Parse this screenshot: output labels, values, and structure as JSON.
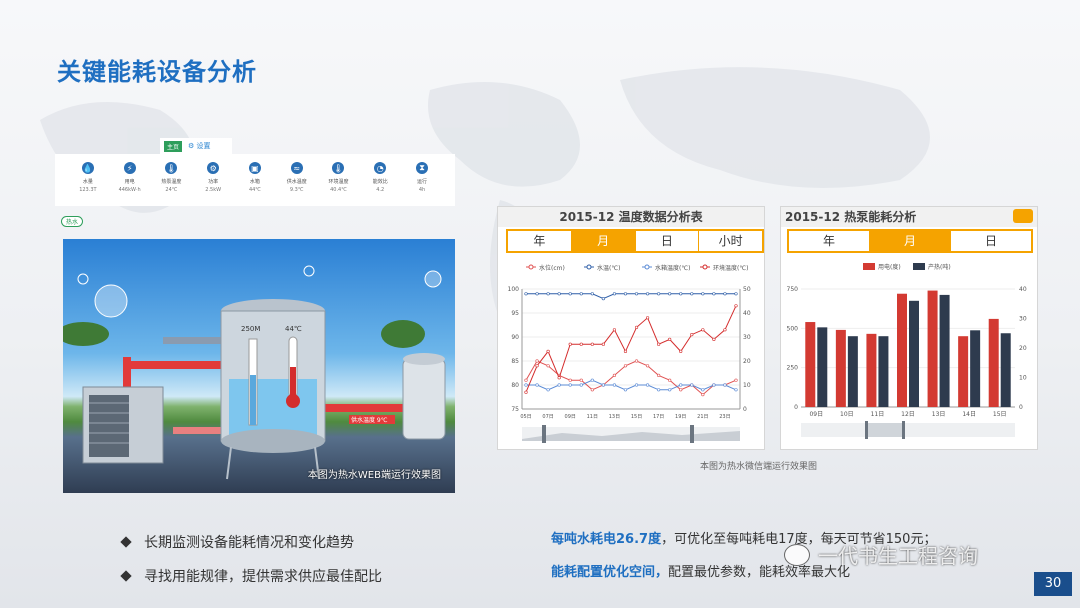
{
  "slide": {
    "title": "关键能耗设备分析",
    "page_number": "30"
  },
  "left_screenshot": {
    "tab_green": "主页",
    "tab_settings": "设置",
    "logo": "热水",
    "sensors": [
      {
        "icon": "water-drop-icon",
        "label": "水量",
        "value": "123.3T"
      },
      {
        "icon": "bolt-icon",
        "label": "用电",
        "value": "446kW·h"
      },
      {
        "icon": "thermometer-icon",
        "label": "热泵温度",
        "value": "24℃"
      },
      {
        "icon": "pump-icon",
        "label": "功率",
        "value": "2.5kW"
      },
      {
        "icon": "tank-icon",
        "label": "水箱",
        "value": "44℃"
      },
      {
        "icon": "pipe-icon",
        "label": "供水温度",
        "value": "9.3℃"
      },
      {
        "icon": "thermo-icon",
        "label": "环境温度",
        "value": "40.4℃"
      },
      {
        "icon": "gauge-icon",
        "label": "能效比",
        "value": "4.2"
      },
      {
        "icon": "hourglass-icon",
        "label": "运行",
        "value": "4h"
      }
    ],
    "tank_level_label": "250M",
    "tank_temp_label": "44℃",
    "pipe_label": "供水温度 9℃",
    "caption": "本图为热水WEB端运行效果图"
  },
  "temp_panel": {
    "title": "2015-12 温度数据分析表",
    "tabs": [
      "年",
      "月",
      "日",
      "小时"
    ],
    "active_tab": "月",
    "legend": [
      "水位(cm)",
      "水温(℃)",
      "水箱温度(℃)",
      "环境温度(℃)"
    ]
  },
  "energy_panel": {
    "title": "2015-12 热泵能耗分析",
    "tabs": [
      "年",
      "月",
      "日"
    ],
    "active_tab": "月",
    "legend": [
      "用电(度)",
      "产热(吨)"
    ]
  },
  "caption_right": "本图为热水微信端运行效果图",
  "bullets": [
    "长期监测设备能耗情况和变化趋势",
    "寻找用能规律，提供需求供应最佳配比"
  ],
  "notes": {
    "line1_highlight": "每吨水耗电",
    "line1_value": "26.7度",
    "line1_rest": "，可优化至每吨耗电17度，每天可节省150元；",
    "line2_highlight": "能耗配置优化空间，",
    "line2_rest": "配置最优参数，能耗效率最大化"
  },
  "watermark": "一代书生工程咨询",
  "chart_data": [
    {
      "type": "line",
      "title": "2015-12 温度数据分析表",
      "x": [
        "05日",
        "06日",
        "07日",
        "08日",
        "09日",
        "10日",
        "11日",
        "12日",
        "13日",
        "14日",
        "15日",
        "16日",
        "17日",
        "18日",
        "19日",
        "20日",
        "21日",
        "22日",
        "23日",
        "24日"
      ],
      "ylim_left": [
        75,
        100
      ],
      "ylim_right": [
        0,
        50
      ],
      "yticks_left": [
        75,
        80,
        85,
        90,
        95,
        100
      ],
      "yticks_right": [
        0,
        10,
        20,
        30,
        40,
        50
      ],
      "series": [
        {
          "name": "水位(cm)",
          "color": "#e05252",
          "axis": "left",
          "values": [
            81,
            85,
            84,
            82,
            81,
            81,
            79,
            80,
            82,
            84,
            85,
            84,
            82,
            81,
            79,
            80,
            78,
            80,
            80,
            81
          ]
        },
        {
          "name": "水温(℃)",
          "color": "#2f5fa8",
          "axis": "left",
          "values": [
            99,
            99,
            99,
            99,
            99,
            99,
            99,
            98,
            99,
            99,
            99,
            99,
            99,
            99,
            99,
            99,
            99,
            99,
            99,
            99
          ]
        },
        {
          "name": "水箱温度(℃)",
          "color": "#5b8bd6",
          "axis": "left",
          "values": [
            80,
            80,
            79,
            80,
            80,
            80,
            81,
            80,
            80,
            79,
            80,
            80,
            79,
            79,
            80,
            80,
            79,
            80,
            80,
            79
          ]
        },
        {
          "name": "环境温度(℃)",
          "color": "#d42d2d",
          "axis": "right",
          "values": [
            7,
            18,
            24,
            13,
            27,
            27,
            27,
            27,
            33,
            24,
            34,
            38,
            27,
            29,
            24,
            31,
            33,
            29,
            33,
            43
          ]
        }
      ],
      "grid": true,
      "legend": "top"
    },
    {
      "type": "bar",
      "title": "2015-12 热泵能耗分析",
      "categories": [
        "09日",
        "10日",
        "11日",
        "12日",
        "13日",
        "14日",
        "15日"
      ],
      "ylim_left": [
        0,
        750
      ],
      "ylim_right": [
        0,
        40
      ],
      "yticks_left": [
        0,
        250,
        500,
        750
      ],
      "yticks_right": [
        0,
        10,
        20,
        30,
        40
      ],
      "series": [
        {
          "name": "用电(度)",
          "color": "#d33a32",
          "axis": "left",
          "values": [
            540,
            490,
            465,
            720,
            740,
            450,
            560
          ]
        },
        {
          "name": "产热(吨)",
          "color": "#2e3b4e",
          "axis": "right",
          "values": [
            27,
            24,
            24,
            36,
            38,
            26,
            25
          ]
        }
      ],
      "grid": true,
      "legend": "top"
    }
  ]
}
